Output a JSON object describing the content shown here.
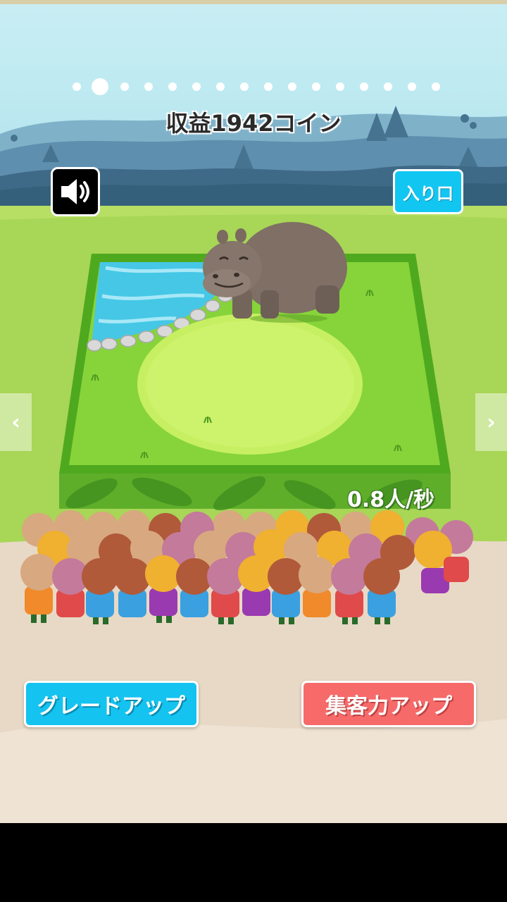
{
  "page_indicator": {
    "count": 16,
    "active_index": 1
  },
  "header": {
    "title": "収益1942コイン"
  },
  "buttons": {
    "sound_icon": "speaker-icon",
    "entrance_label": "入り口",
    "prev_arrow": "‹",
    "next_arrow": "›",
    "grade_up_label": "グレードアップ",
    "attract_up_label": "集客力アップ"
  },
  "enclosure": {
    "animal": "hippo",
    "visitor_rate": "0.8人/秒"
  },
  "colors": {
    "grade_button": "#14c3f0",
    "attract_button": "#f76a6a",
    "entrance_button": "#12c6f2"
  }
}
